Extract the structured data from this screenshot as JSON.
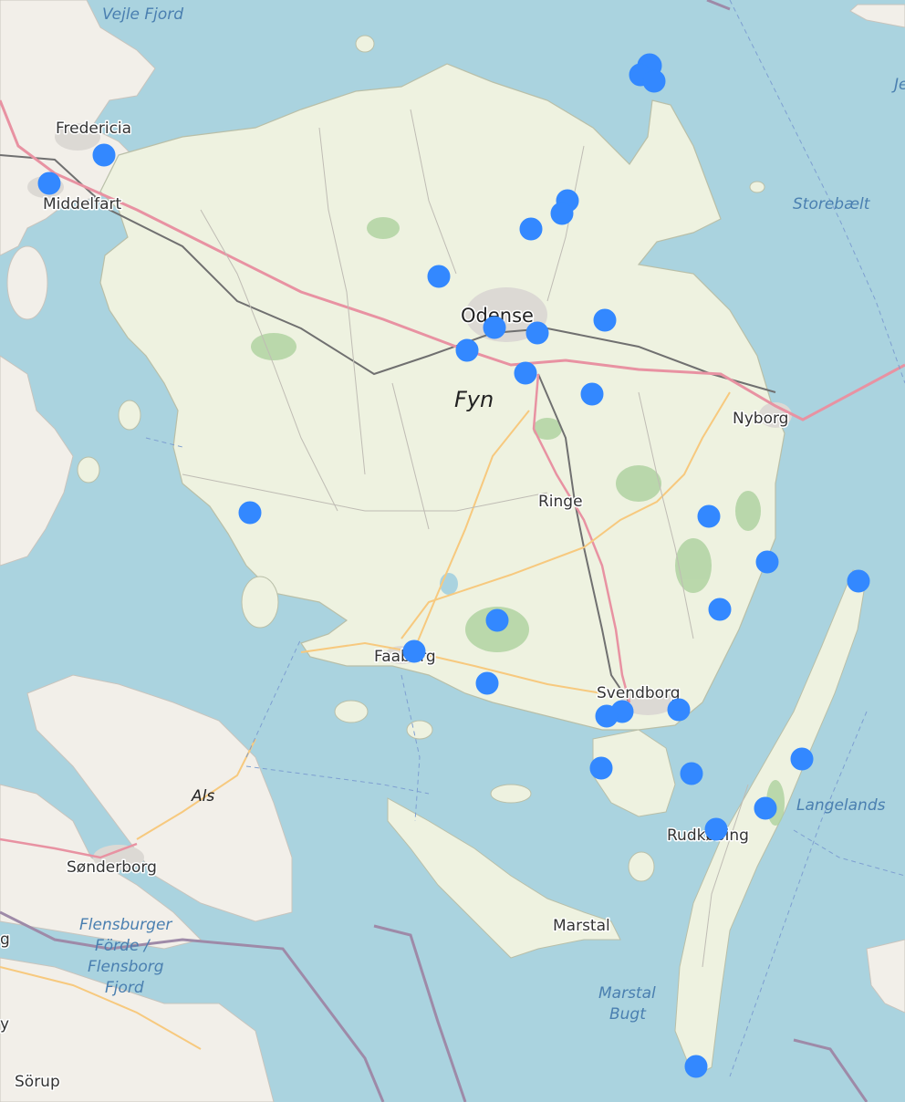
{
  "map": {
    "water_color": "#aad3df",
    "land_color": "#f2efe9",
    "marker_color": "#3388ff",
    "labels": {
      "vejle_fjord": "Vejle Fjord",
      "fredericia": "Fredericia",
      "middelfart": "Middelfart",
      "odense": "Odense",
      "fyn": "Fyn",
      "nyborg": "Nyborg",
      "storebaelt": "Storebælt",
      "ringe": "Ringe",
      "faaborg": "Faaborg",
      "svendborg": "Svendborg",
      "rudkobing": "Rudkøbing",
      "langelands": "Langelands",
      "marstal": "Marstal",
      "marstal_bugt": "Marstal\nBugt",
      "als": "Als",
      "sonderborg": "Sønderborg",
      "flensburger_1": "Flensburger",
      "flensburger_2": "Förde /",
      "flensburger_3": "Flensborg",
      "flensburger_4": "Fjord",
      "sorup": "Sörup",
      "edge_je": "Je",
      "edge_g": "g",
      "edge_y": "y"
    },
    "marker_count": 35
  }
}
